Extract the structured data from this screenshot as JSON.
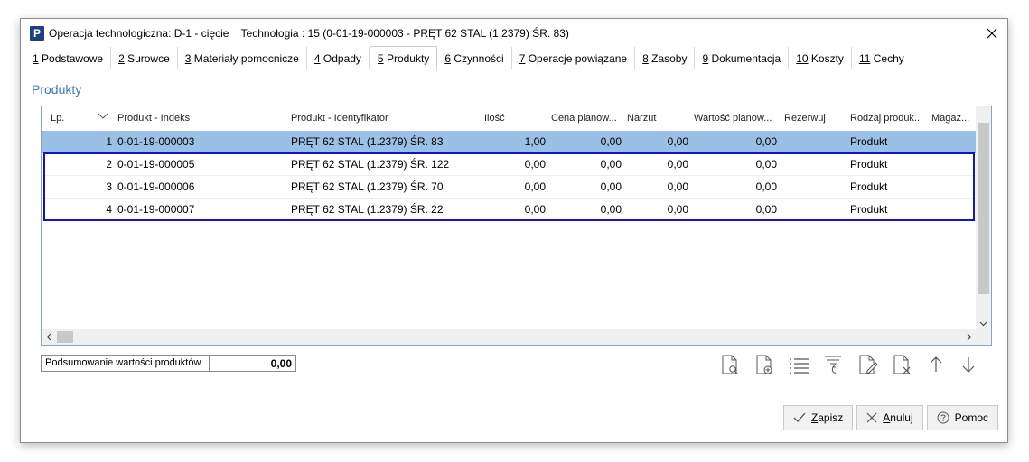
{
  "window": {
    "app_icon": "P",
    "title": "Operacja technologiczna: D-1 - cięcie    Technologia : 15 (0-01-19-000003 - PRĘT 62 STAL (1.2379) ŚR. 83)"
  },
  "tabs": [
    {
      "key": "1",
      "label": " Podstawowe"
    },
    {
      "key": "2",
      "label": " Surowce"
    },
    {
      "key": "3",
      "label": " Materiały pomocnicze"
    },
    {
      "key": "4",
      "label": " Odpady"
    },
    {
      "key": "5",
      "label": " Produkty"
    },
    {
      "key": "6",
      "label": " Czynności"
    },
    {
      "key": "7",
      "label": " Operacje powiązane"
    },
    {
      "key": "8",
      "label": " Zasoby"
    },
    {
      "key": "9",
      "label": " Dokumentacja"
    },
    {
      "key": "10",
      "label": " Koszty"
    },
    {
      "key": "11",
      "label": " Cechy"
    }
  ],
  "section_title": "Produkty",
  "grid": {
    "headers": {
      "lp": "Lp.",
      "indeks": "Produkt - Indeks",
      "ident": "Produkt - Identyfikator",
      "ilosc": "Ilość",
      "cena": "Cena planow...",
      "narzut": "Narzut",
      "wartosc": "Wartość planow...",
      "rezerwuj": "Rezerwuj",
      "rodzaj": "Rodzaj produk...",
      "magazyn": "Magaz..."
    },
    "rows": [
      {
        "lp": "1",
        "indeks": "0-01-19-000003",
        "ident": "PRĘT 62 STAL (1.2379) ŚR. 83",
        "ilosc": "1,00",
        "cena": "0,00",
        "narzut": "0,00",
        "wartosc": "0,00",
        "rodzaj": "Produkt"
      },
      {
        "lp": "2",
        "indeks": "0-01-19-000005",
        "ident": "PRĘT 62 STAL (1.2379) ŚR. 122",
        "ilosc": "0,00",
        "cena": "0,00",
        "narzut": "0,00",
        "wartosc": "0,00",
        "rodzaj": "Produkt"
      },
      {
        "lp": "3",
        "indeks": "0-01-19-000006",
        "ident": "PRĘT 62 STAL (1.2379) ŚR. 70",
        "ilosc": "0,00",
        "cena": "0,00",
        "narzut": "0,00",
        "wartosc": "0,00",
        "rodzaj": "Produkt"
      },
      {
        "lp": "4",
        "indeks": "0-01-19-000007",
        "ident": "PRĘT 62 STAL (1.2379) ŚR. 22",
        "ilosc": "0,00",
        "cena": "0,00",
        "narzut": "0,00",
        "wartosc": "0,00",
        "rodzaj": "Produkt"
      }
    ]
  },
  "summary": {
    "label": "Podsumowanie wartości produktów",
    "value": "0,00"
  },
  "buttons": {
    "save_hk": "Z",
    "save_rest": "apisz",
    "cancel_hk": "A",
    "cancel_rest": "nuluj",
    "help": "Pomoc"
  },
  "colors": {
    "accent": "#3d7cc1",
    "selection": "#9ac0e6",
    "highlight_box": "#1212c8"
  }
}
